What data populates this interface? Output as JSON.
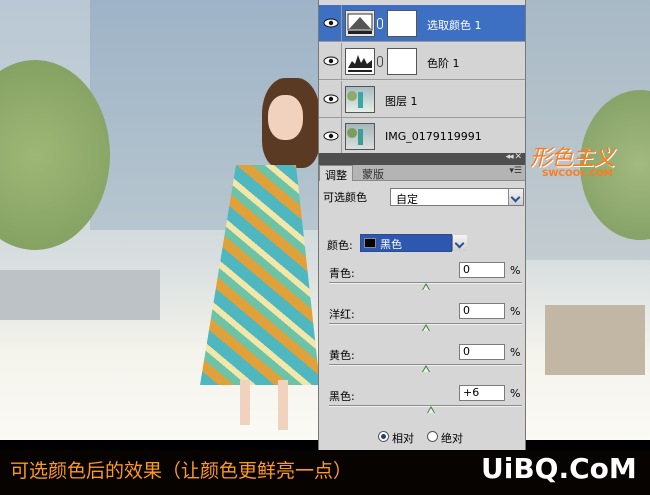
{
  "layers": [
    {
      "name": "选取颜色 1",
      "selected": true,
      "type": "adjustment-selective-color"
    },
    {
      "name": "色阶 1",
      "selected": false,
      "type": "adjustment-levels"
    },
    {
      "name": "图层 1",
      "selected": false,
      "type": "pixel"
    },
    {
      "name": "IMG_0179119991",
      "selected": false,
      "type": "pixel"
    }
  ],
  "panel": {
    "tabs": [
      {
        "label": "调整",
        "active": true
      },
      {
        "label": "蒙版",
        "active": false
      }
    ],
    "title": "可选颜色",
    "preset_value": "自定",
    "colors_label": "颜色:",
    "colors_value": "黑色",
    "sliders": [
      {
        "label": "青色:",
        "value": "0",
        "level": 0
      },
      {
        "label": "洋红:",
        "value": "0",
        "level": 0
      },
      {
        "label": "黄色:",
        "value": "0",
        "level": 0
      },
      {
        "label": "黑色:",
        "value": "+6",
        "level": 6
      }
    ],
    "percent": "%",
    "method": [
      {
        "label": "相对",
        "checked": true
      },
      {
        "label": "绝对",
        "checked": false
      }
    ]
  },
  "watermark": {
    "logo": "形色主义",
    "sub": "SWCOOL.COM"
  },
  "caption": "可选颜色后的效果（让颜色更鲜亮一点）",
  "site_logo": "UiBQ.CoM",
  "colors": {
    "selected_layer": "#3d6fc2",
    "caption_text": "#ff9a1c",
    "watermark": "#ff7a1a"
  }
}
